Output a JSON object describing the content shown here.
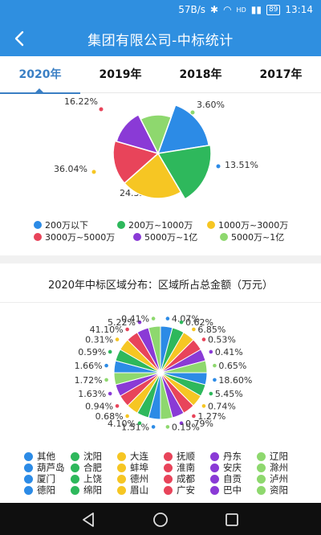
{
  "status": {
    "speed": "57B/s",
    "battery": "89",
    "time": "13:14",
    "hd": "HD"
  },
  "header": {
    "title": "集团有限公司-中标统计"
  },
  "tabs": [
    {
      "label": "2020年",
      "active": true
    },
    {
      "label": "2019年",
      "active": false
    },
    {
      "label": "2018年",
      "active": false
    },
    {
      "label": "2017年",
      "active": false
    }
  ],
  "chart_data": [
    {
      "type": "pie",
      "title": "",
      "rose": true,
      "series": [
        {
          "name": "200万以下",
          "value": 13.51,
          "label": "13.51%",
          "color": "#2c8be6"
        },
        {
          "name": "200万~1000万",
          "value": 24.32,
          "label": "24.32%",
          "color": "#2eb85c"
        },
        {
          "name": "1000万~3000万",
          "value": 36.04,
          "label": "36.04%",
          "color": "#f6c623"
        },
        {
          "name": "3000万~5000万",
          "value": 16.22,
          "label": "16.22%",
          "color": "#e8445a"
        },
        {
          "name": "5000万~1亿",
          "value": 6.31,
          "label": "",
          "color": "#8a3ad6"
        },
        {
          "name": "5000万~1亿",
          "value": 3.6,
          "label": "3.60%",
          "color": "#8ed86e"
        }
      ]
    },
    {
      "type": "pie",
      "title": "2020年中标区域分布：区域所占总金额（万元）",
      "series": [
        {
          "name": "其他",
          "value": 4.07,
          "label": "4.07%",
          "color": "#2c8be6"
        },
        {
          "name": "沈阳",
          "value": 0.62,
          "label": "0.62%",
          "color": "#2eb85c"
        },
        {
          "name": "大连",
          "value": 6.85,
          "label": "6.85%",
          "color": "#f6c623"
        },
        {
          "name": "抚顺",
          "value": 0.53,
          "label": "0.53%",
          "color": "#e8445a"
        },
        {
          "name": "丹东",
          "value": 0.41,
          "label": "0.41%",
          "color": "#8a3ad6"
        },
        {
          "name": "辽阳",
          "value": 0.65,
          "label": "0.65%",
          "color": "#8ed86e"
        },
        {
          "name": "葫芦岛",
          "value": 18.6,
          "label": "18.60%",
          "color": "#2c8be6"
        },
        {
          "name": "合肥",
          "value": 5.45,
          "label": "5.45%",
          "color": "#2eb85c"
        },
        {
          "name": "蚌埠",
          "value": 0.74,
          "label": "0.74%",
          "color": "#f6c623"
        },
        {
          "name": "淮南",
          "value": 1.27,
          "label": "1.27%",
          "color": "#e8445a"
        },
        {
          "name": "安庆",
          "value": 0.79,
          "label": "0.79%",
          "color": "#8a3ad6"
        },
        {
          "name": "滁州",
          "value": 0.15,
          "label": "0.15%",
          "color": "#8ed86e"
        },
        {
          "name": "厦门",
          "value": 1.51,
          "label": "1.51%",
          "color": "#2c8be6"
        },
        {
          "name": "上饶",
          "value": 4.1,
          "label": "4.10%",
          "color": "#2eb85c"
        },
        {
          "name": "德州",
          "value": 0.68,
          "label": "0.68%",
          "color": "#f6c623"
        },
        {
          "name": "成都",
          "value": 0.94,
          "label": "0.94%",
          "color": "#e8445a"
        },
        {
          "name": "自贡",
          "value": 1.63,
          "label": "1.63%",
          "color": "#8a3ad6"
        },
        {
          "name": "泸州",
          "value": 1.72,
          "label": "1.72%",
          "color": "#8ed86e"
        },
        {
          "name": "德阳",
          "value": 1.66,
          "label": "1.66%",
          "color": "#2c8be6"
        },
        {
          "name": "绵阳",
          "value": 0.59,
          "label": "0.59%",
          "color": "#2eb85c"
        },
        {
          "name": "眉山",
          "value": 0.31,
          "label": "0.31%",
          "color": "#f6c623"
        },
        {
          "name": "广安",
          "value": 41.1,
          "label": "41.10%",
          "color": "#e8445a"
        },
        {
          "name": "巴中",
          "value": 5.22,
          "label": "5.22%",
          "color": "#8a3ad6"
        },
        {
          "name": "资阳",
          "value": 0.41,
          "label": "0.41%",
          "color": "#8ed86e"
        }
      ]
    }
  ],
  "legend1": [
    {
      "label": "200万以下",
      "color": "#2c8be6"
    },
    {
      "label": "200万~1000万",
      "color": "#2eb85c"
    },
    {
      "label": "1000万~3000万",
      "color": "#f6c623"
    },
    {
      "label": "3000万~5000万",
      "color": "#e8445a"
    },
    {
      "label": "5000万~1亿",
      "color": "#8a3ad6"
    },
    {
      "label": "5000万~1亿",
      "color": "#8ed86e"
    }
  ],
  "legend2": [
    {
      "label": "其他",
      "color": "#2c8be6"
    },
    {
      "label": "沈阳",
      "color": "#2eb85c"
    },
    {
      "label": "大连",
      "color": "#f6c623"
    },
    {
      "label": "抚顺",
      "color": "#e8445a"
    },
    {
      "label": "丹东",
      "color": "#8a3ad6"
    },
    {
      "label": "辽阳",
      "color": "#8ed86e"
    },
    {
      "label": "葫芦岛",
      "color": "#2c8be6"
    },
    {
      "label": "合肥",
      "color": "#2eb85c"
    },
    {
      "label": "蚌埠",
      "color": "#f6c623"
    },
    {
      "label": "淮南",
      "color": "#e8445a"
    },
    {
      "label": "安庆",
      "color": "#8a3ad6"
    },
    {
      "label": "滁州",
      "color": "#8ed86e"
    },
    {
      "label": "厦门",
      "color": "#2c8be6"
    },
    {
      "label": "上饶",
      "color": "#2eb85c"
    },
    {
      "label": "德州",
      "color": "#f6c623"
    },
    {
      "label": "成都",
      "color": "#e8445a"
    },
    {
      "label": "自贡",
      "color": "#8a3ad6"
    },
    {
      "label": "泸州",
      "color": "#8ed86e"
    },
    {
      "label": "德阳",
      "color": "#2c8be6"
    },
    {
      "label": "绵阳",
      "color": "#2eb85c"
    },
    {
      "label": "眉山",
      "color": "#f6c623"
    },
    {
      "label": "广安",
      "color": "#e8445a"
    },
    {
      "label": "巴中",
      "color": "#8a3ad6"
    },
    {
      "label": "资阳",
      "color": "#8ed86e"
    }
  ],
  "icons": {
    "back": "back-arrow-icon",
    "nav": [
      "nav-back-icon",
      "nav-home-icon",
      "nav-recents-icon"
    ]
  }
}
